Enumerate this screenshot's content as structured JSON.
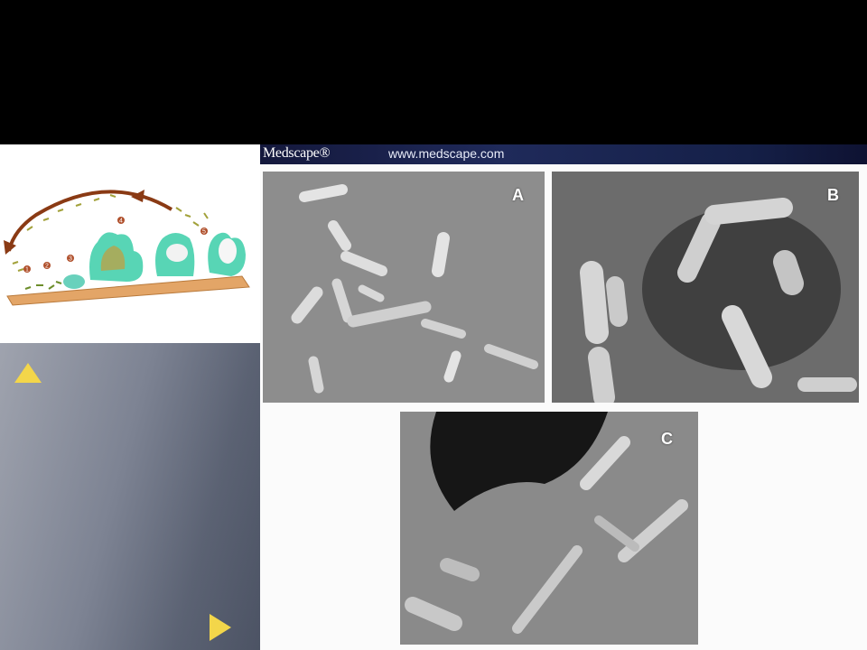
{
  "figure": {
    "brand": "Medscape®",
    "url": "www.medscape.com",
    "panels": [
      {
        "label": "A"
      },
      {
        "label": "B"
      },
      {
        "label": "C"
      }
    ]
  },
  "biofilm_diagram": {
    "stages": [
      "1",
      "2",
      "3",
      "4",
      "5"
    ]
  },
  "navigation": {
    "up_icon": "triangle-up-icon",
    "next_icon": "triangle-right-icon",
    "accent_color": "#f3d64a"
  }
}
